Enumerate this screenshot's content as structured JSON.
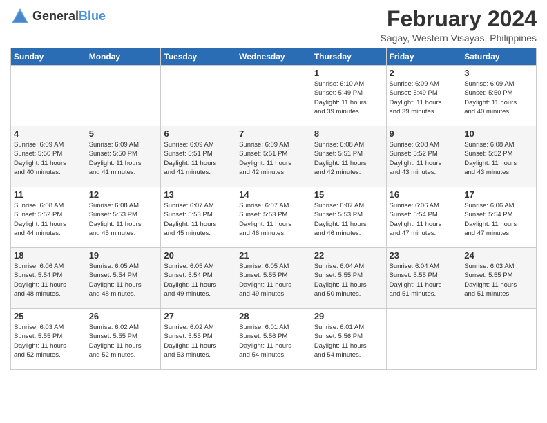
{
  "header": {
    "logo_general": "General",
    "logo_blue": "Blue",
    "month_year": "February 2024",
    "location": "Sagay, Western Visayas, Philippines"
  },
  "days_of_week": [
    "Sunday",
    "Monday",
    "Tuesday",
    "Wednesday",
    "Thursday",
    "Friday",
    "Saturday"
  ],
  "weeks": [
    [
      {
        "day": "",
        "info": ""
      },
      {
        "day": "",
        "info": ""
      },
      {
        "day": "",
        "info": ""
      },
      {
        "day": "",
        "info": ""
      },
      {
        "day": "1",
        "info": "Sunrise: 6:10 AM\nSunset: 5:49 PM\nDaylight: 11 hours\nand 39 minutes."
      },
      {
        "day": "2",
        "info": "Sunrise: 6:09 AM\nSunset: 5:49 PM\nDaylight: 11 hours\nand 39 minutes."
      },
      {
        "day": "3",
        "info": "Sunrise: 6:09 AM\nSunset: 5:50 PM\nDaylight: 11 hours\nand 40 minutes."
      }
    ],
    [
      {
        "day": "4",
        "info": "Sunrise: 6:09 AM\nSunset: 5:50 PM\nDaylight: 11 hours\nand 40 minutes."
      },
      {
        "day": "5",
        "info": "Sunrise: 6:09 AM\nSunset: 5:50 PM\nDaylight: 11 hours\nand 41 minutes."
      },
      {
        "day": "6",
        "info": "Sunrise: 6:09 AM\nSunset: 5:51 PM\nDaylight: 11 hours\nand 41 minutes."
      },
      {
        "day": "7",
        "info": "Sunrise: 6:09 AM\nSunset: 5:51 PM\nDaylight: 11 hours\nand 42 minutes."
      },
      {
        "day": "8",
        "info": "Sunrise: 6:08 AM\nSunset: 5:51 PM\nDaylight: 11 hours\nand 42 minutes."
      },
      {
        "day": "9",
        "info": "Sunrise: 6:08 AM\nSunset: 5:52 PM\nDaylight: 11 hours\nand 43 minutes."
      },
      {
        "day": "10",
        "info": "Sunrise: 6:08 AM\nSunset: 5:52 PM\nDaylight: 11 hours\nand 43 minutes."
      }
    ],
    [
      {
        "day": "11",
        "info": "Sunrise: 6:08 AM\nSunset: 5:52 PM\nDaylight: 11 hours\nand 44 minutes."
      },
      {
        "day": "12",
        "info": "Sunrise: 6:08 AM\nSunset: 5:53 PM\nDaylight: 11 hours\nand 45 minutes."
      },
      {
        "day": "13",
        "info": "Sunrise: 6:07 AM\nSunset: 5:53 PM\nDaylight: 11 hours\nand 45 minutes."
      },
      {
        "day": "14",
        "info": "Sunrise: 6:07 AM\nSunset: 5:53 PM\nDaylight: 11 hours\nand 46 minutes."
      },
      {
        "day": "15",
        "info": "Sunrise: 6:07 AM\nSunset: 5:53 PM\nDaylight: 11 hours\nand 46 minutes."
      },
      {
        "day": "16",
        "info": "Sunrise: 6:06 AM\nSunset: 5:54 PM\nDaylight: 11 hours\nand 47 minutes."
      },
      {
        "day": "17",
        "info": "Sunrise: 6:06 AM\nSunset: 5:54 PM\nDaylight: 11 hours\nand 47 minutes."
      }
    ],
    [
      {
        "day": "18",
        "info": "Sunrise: 6:06 AM\nSunset: 5:54 PM\nDaylight: 11 hours\nand 48 minutes."
      },
      {
        "day": "19",
        "info": "Sunrise: 6:05 AM\nSunset: 5:54 PM\nDaylight: 11 hours\nand 48 minutes."
      },
      {
        "day": "20",
        "info": "Sunrise: 6:05 AM\nSunset: 5:54 PM\nDaylight: 11 hours\nand 49 minutes."
      },
      {
        "day": "21",
        "info": "Sunrise: 6:05 AM\nSunset: 5:55 PM\nDaylight: 11 hours\nand 49 minutes."
      },
      {
        "day": "22",
        "info": "Sunrise: 6:04 AM\nSunset: 5:55 PM\nDaylight: 11 hours\nand 50 minutes."
      },
      {
        "day": "23",
        "info": "Sunrise: 6:04 AM\nSunset: 5:55 PM\nDaylight: 11 hours\nand 51 minutes."
      },
      {
        "day": "24",
        "info": "Sunrise: 6:03 AM\nSunset: 5:55 PM\nDaylight: 11 hours\nand 51 minutes."
      }
    ],
    [
      {
        "day": "25",
        "info": "Sunrise: 6:03 AM\nSunset: 5:55 PM\nDaylight: 11 hours\nand 52 minutes."
      },
      {
        "day": "26",
        "info": "Sunrise: 6:02 AM\nSunset: 5:55 PM\nDaylight: 11 hours\nand 52 minutes."
      },
      {
        "day": "27",
        "info": "Sunrise: 6:02 AM\nSunset: 5:55 PM\nDaylight: 11 hours\nand 53 minutes."
      },
      {
        "day": "28",
        "info": "Sunrise: 6:01 AM\nSunset: 5:56 PM\nDaylight: 11 hours\nand 54 minutes."
      },
      {
        "day": "29",
        "info": "Sunrise: 6:01 AM\nSunset: 5:56 PM\nDaylight: 11 hours\nand 54 minutes."
      },
      {
        "day": "",
        "info": ""
      },
      {
        "day": "",
        "info": ""
      }
    ]
  ]
}
